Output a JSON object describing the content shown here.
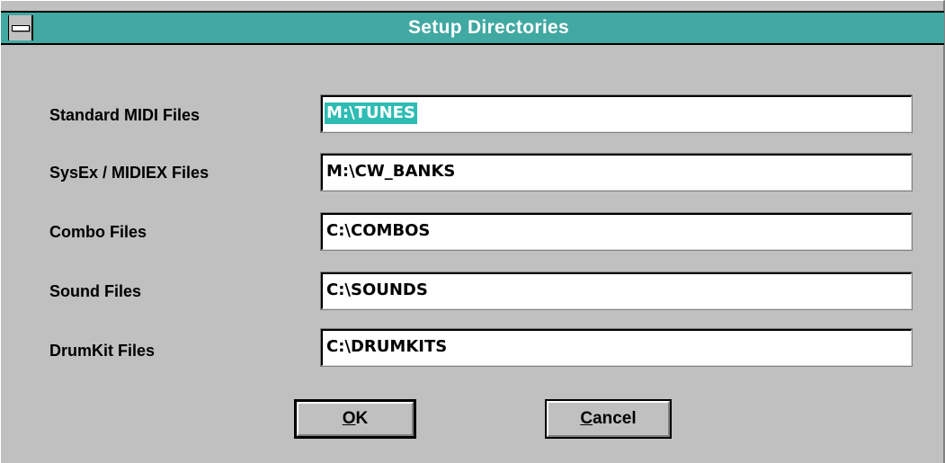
{
  "window": {
    "title": "Setup Directories"
  },
  "fields": [
    {
      "label": "Standard MIDI Files",
      "value": "M:\\TUNES",
      "selected": true
    },
    {
      "label": "SysEx / MIDIEX Files",
      "value": "M:\\CW_BANKS",
      "selected": false
    },
    {
      "label": "Combo Files",
      "value": "C:\\COMBOS",
      "selected": false
    },
    {
      "label": "Sound Files",
      "value": "C:\\SOUNDS",
      "selected": false
    },
    {
      "label": "DrumKit Files",
      "value": "C:\\DRUMKITS",
      "selected": false
    }
  ],
  "buttons": {
    "ok": {
      "mnemonic": "O",
      "rest": "K"
    },
    "cancel": {
      "mnemonic": "C",
      "rest": "ancel"
    }
  },
  "colors": {
    "titlebar": "#41a8a2",
    "selection": "#2ebcb3",
    "face": "#c0c0c0"
  },
  "icons": {
    "system_menu": "system-menu-icon"
  }
}
